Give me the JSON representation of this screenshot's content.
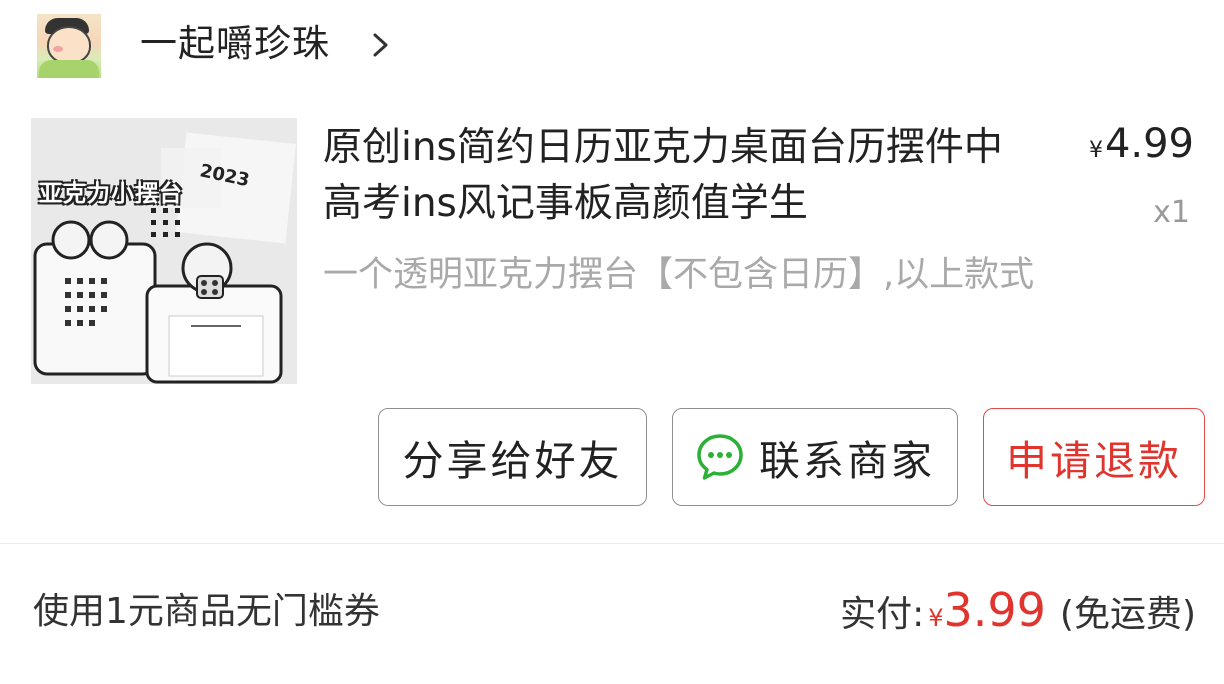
{
  "shop": {
    "name": "一起嚼珍珠",
    "avatar_icon": "cartoon-avatar-icon",
    "chevron_icon": "chevron-right-icon"
  },
  "product": {
    "thumbnail_text": "亚克力小摆台",
    "title": "原创ins简约日历亚克力桌面台历摆件中高考ins风记事板高颜值学生",
    "spec": "一个透明亚克力摆台【不包含日历】,以上款式",
    "currency": "¥",
    "price": "4.99",
    "quantity": "x1"
  },
  "actions": {
    "share_label": "分享给好友",
    "contact_label": "联系商家",
    "contact_icon": "chat-bubble-icon",
    "refund_label": "申请退款"
  },
  "summary": {
    "coupon_text": "使用1元商品无门槛券",
    "paid_label": "实付:",
    "currency": "¥",
    "paid_amount": "3.99",
    "shipping_note": "(免运费)"
  },
  "colors": {
    "accent_red": "#e0352f",
    "wechat_green": "#2bb135",
    "muted_text": "#a9a9a9"
  }
}
